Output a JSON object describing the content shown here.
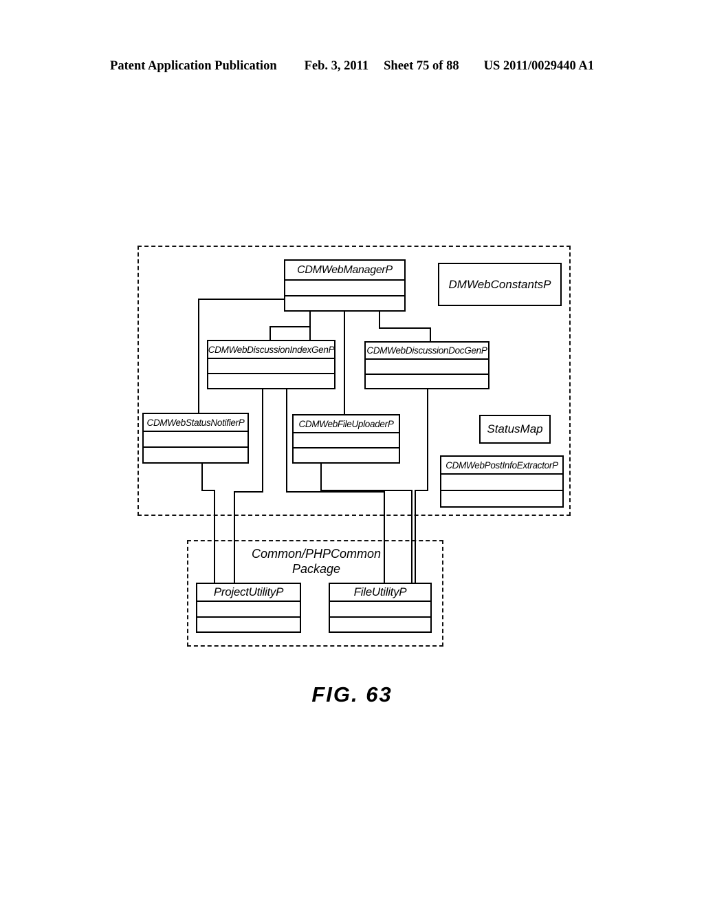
{
  "header": {
    "publication": "Patent Application Publication",
    "date": "Feb. 3, 2011",
    "sheet": "Sheet 75 of 88",
    "number": "US 2011/0029440 A1"
  },
  "figure": {
    "caption": "FIG. 63"
  },
  "diagram": {
    "type": "uml-class-diagram",
    "packages": [
      {
        "id": "web-package",
        "label": "",
        "style": "dashed"
      },
      {
        "id": "common-package",
        "label": "Common/PHPCommon\nPackage",
        "style": "dashed"
      }
    ],
    "classes": [
      {
        "id": "cdm-web-manager-p",
        "name": "CDMWebManagerP",
        "compartments": 3
      },
      {
        "id": "dm-web-constants-p",
        "name": "DMWebConstantsP",
        "compartments": 1
      },
      {
        "id": "cdm-web-discussion-index-gen-p",
        "name": "CDMWebDiscussionIndexGenP",
        "compartments": 3
      },
      {
        "id": "cdm-web-discussion-doc-gen-p",
        "name": "CDMWebDiscussionDocGenP",
        "compartments": 3
      },
      {
        "id": "cdm-web-status-notifier-p",
        "name": "CDMWebStatusNotifierP",
        "compartments": 3
      },
      {
        "id": "cdm-web-file-uploader-p",
        "name": "CDMWebFileUploaderP",
        "compartments": 3
      },
      {
        "id": "status-map",
        "name": "StatusMap",
        "compartments": 1
      },
      {
        "id": "cdm-web-post-info-extractor-p",
        "name": "CDMWebPostInfoExtractorP",
        "compartments": 3
      },
      {
        "id": "project-utility-p",
        "name": "ProjectUtilityP",
        "compartments": 3
      },
      {
        "id": "file-utility-p",
        "name": "FileUtilityP",
        "compartments": 3
      }
    ],
    "associations": [
      {
        "from": "cdm-web-manager-p",
        "to": "cdm-web-status-notifier-p"
      },
      {
        "from": "cdm-web-manager-p",
        "to": "cdm-web-discussion-index-gen-p"
      },
      {
        "from": "cdm-web-manager-p",
        "to": "cdm-web-file-uploader-p"
      },
      {
        "from": "cdm-web-manager-p",
        "to": "cdm-web-discussion-doc-gen-p"
      },
      {
        "from": "cdm-web-discussion-index-gen-p",
        "to": "project-utility-p"
      },
      {
        "from": "cdm-web-discussion-index-gen-p",
        "to": "file-utility-p"
      },
      {
        "from": "cdm-web-status-notifier-p",
        "to": "project-utility-p"
      },
      {
        "from": "cdm-web-file-uploader-p",
        "to": "file-utility-p"
      },
      {
        "from": "cdm-web-discussion-doc-gen-p",
        "to": "file-utility-p"
      }
    ]
  }
}
